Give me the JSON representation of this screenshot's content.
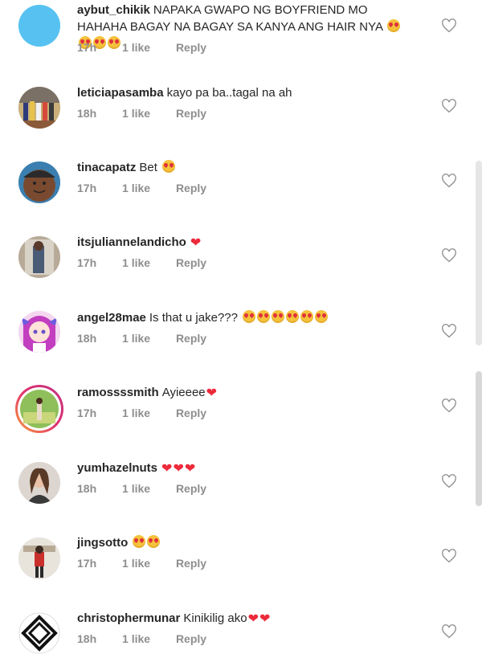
{
  "comments": [
    {
      "username": "aybut_chikik",
      "text": "NAPAKA GWAPO NG BOYFRIEND MO HAHAHA BAGAY NA BAGAY SA KANYA ANG HAIR NYA",
      "emoji": "heart-eyes-emoji x4",
      "time": "17h",
      "likes": "1 like",
      "reply": "Reply"
    },
    {
      "username": "leticiapasamba",
      "text": "kayo pa ba..tagal na ah",
      "time": "18h",
      "likes": "1 like",
      "reply": "Reply"
    },
    {
      "username": "tinacapatz",
      "text": "Bet",
      "emoji": "heart-eyes-emoji x1",
      "time": "17h",
      "likes": "1 like",
      "reply": "Reply"
    },
    {
      "username": "itsjuliannelandicho",
      "text": "",
      "emoji": "red-heart x1",
      "time": "17h",
      "likes": "1 like",
      "reply": "Reply"
    },
    {
      "username": "angel28mae",
      "text": "Is that u jake???",
      "emoji": "heart-eyes-emoji x6",
      "time": "18h",
      "likes": "1 like",
      "reply": "Reply"
    },
    {
      "username": "ramossssmith",
      "text": "Ayieeee",
      "emoji": "red-heart x1",
      "time": "17h",
      "likes": "1 like",
      "reply": "Reply"
    },
    {
      "username": "yumhazelnuts",
      "text": "",
      "emoji": "red-heart x3",
      "time": "18h",
      "likes": "1 like",
      "reply": "Reply"
    },
    {
      "username": "jingsotto",
      "text": "",
      "emoji": "heart-eyes-emoji x2",
      "time": "17h",
      "likes": "1 like",
      "reply": "Reply"
    },
    {
      "username": "christophermunar",
      "text": "Kinikilig ako",
      "emoji": "red-heart x2",
      "time": "18h",
      "likes": "1 like",
      "reply": "Reply"
    }
  ],
  "icons": {
    "like": "heart-outline-icon"
  },
  "colors": {
    "text": "#262626",
    "meta": "#8e8e8e",
    "heart": "#ed2a3a",
    "emoji": "#f5c23b",
    "story_ring": "#e1306c"
  }
}
